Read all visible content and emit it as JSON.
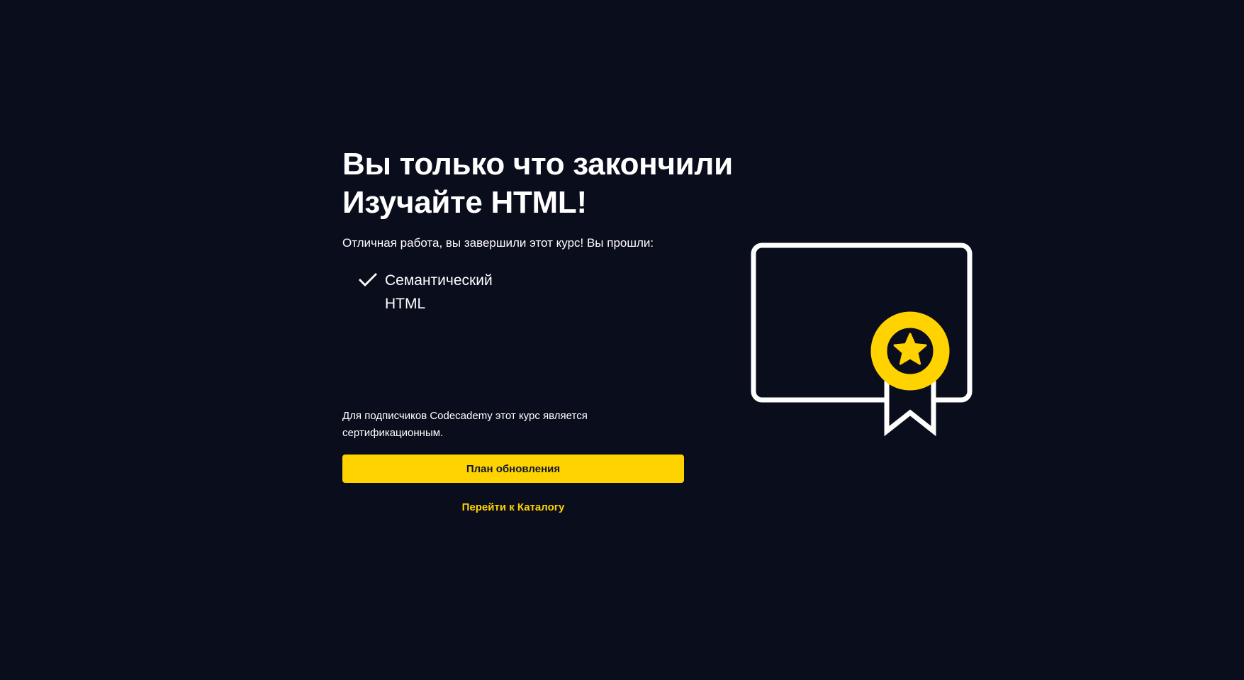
{
  "completion": {
    "title_line1": "Вы только что закончили",
    "title_line2": "Изучайте HTML!",
    "subtitle": "Отличная работа, вы завершили этот курс! Вы прошли:",
    "lessons": [
      {
        "label": "Семантический HTML",
        "icon": "check-icon"
      }
    ],
    "note": "Для подписчиков Codecademy этот курс является сертификационным.",
    "upgrade_button": "План обновления",
    "catalog_link": "Перейти к Каталогу"
  },
  "illustration": {
    "name": "certificate-with-badge",
    "icon": "star-icon"
  },
  "colors": {
    "background": "#0a0d1c",
    "accent": "#ffd300",
    "text": "#ffffff",
    "button_text": "#10162f"
  }
}
